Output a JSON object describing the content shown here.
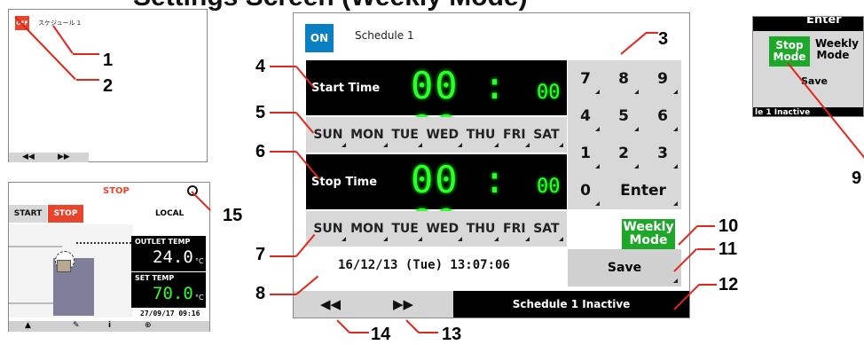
{
  "header": {
    "title": "Settings Screen (Weekly Mode)"
  },
  "callouts": [
    "1",
    "2",
    "3",
    "4",
    "5",
    "6",
    "7",
    "8",
    "9",
    "10",
    "11",
    "12",
    "13",
    "14",
    "15"
  ],
  "screen_top": {
    "off_label": "OFF",
    "schedule_name": "スケジュール 1",
    "nav_prev": "◀◀",
    "nav_next": "▶▶"
  },
  "screen_status": {
    "stop_title": "STOP",
    "start_label": "START",
    "stop_label": "STOP",
    "local_label": "LOCAL",
    "outlet_label": "OUTLET TEMP",
    "outlet_value": "24.0",
    "outlet_unit": "°C",
    "set_label": "SET TEMP",
    "set_value": "70.0",
    "set_unit": "°C",
    "timestamp": "27/09/17 09:16",
    "toolbar_icons": [
      "warning-icon",
      "wrench-icon",
      "info-icon",
      "plus-icon"
    ]
  },
  "main": {
    "on_label": "ON",
    "schedule_title": "Schedule 1",
    "start_time_label": "Start Time",
    "start_hm": "00 : 00",
    "start_sec": "00",
    "stop_time_label": "Stop Time",
    "stop_hm": "00 : 00",
    "stop_sec": "00",
    "days": [
      "SUN",
      "MON",
      "TUE",
      "WED",
      "THU",
      "FRI",
      "SAT"
    ],
    "keys": [
      "7",
      "8",
      "9",
      "4",
      "5",
      "6",
      "1",
      "2",
      "3",
      "0",
      "Enter"
    ],
    "weekly_mode": "Weekly Mode",
    "save": "Save",
    "datetime": "16/12/13 (Tue) 13:07:06",
    "nav_prev": "◀◀",
    "nav_next": "▶▶",
    "status": "Schedule 1 Inactive"
  },
  "crop": {
    "enter_label": "Enter",
    "stop_mode": "Stop Mode",
    "weekly_mode": "Weekly Mode",
    "save": "Save",
    "status_fragment": "le 1 Inactive"
  }
}
